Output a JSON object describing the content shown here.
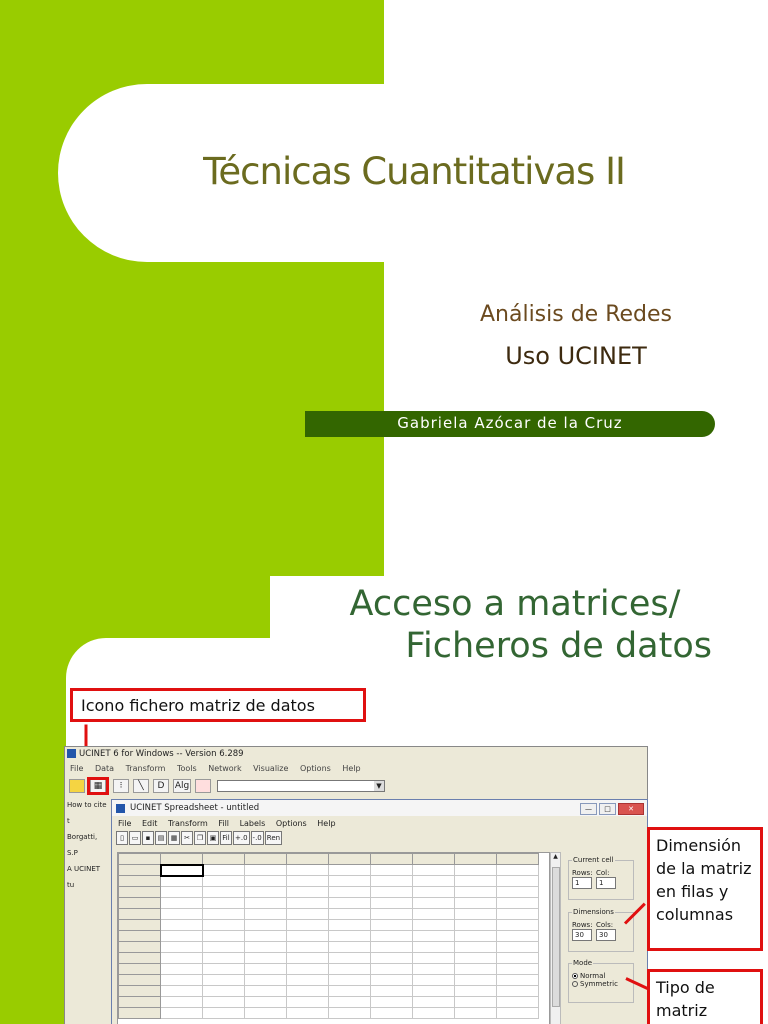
{
  "slide1": {
    "title": "Técnicas Cuantitativas II",
    "subtitle": "Análisis de Redes",
    "subtitle2": "Uso UCINET",
    "author": "Gabriela Azócar de la Cruz"
  },
  "slide2": {
    "title_line1": "Acceso a matrices/",
    "title_line2": "Ficheros de datos",
    "callout_icon": "Icono fichero matriz de datos",
    "callout_dim": "Dimensión de la matriz en filas y columnas",
    "callout_tipo": "Tipo de matriz",
    "colors": {
      "green": "#99cc00",
      "dark_green": "#336600",
      "callout_red": "#e01010"
    }
  },
  "ucinet": {
    "main_title": "UCINET 6 for Windows -- Version 6.289",
    "menu": [
      "File",
      "Data",
      "Transform",
      "Tools",
      "Network",
      "Visualize",
      "Options",
      "Help"
    ],
    "left_lines": [
      "How to cite t",
      "Borgatti, S.P",
      "A UCINET tu"
    ],
    "toolbar_labels": {
      "d": "D",
      "alg": "Alg"
    },
    "sheet_title": "UCINET Spreadsheet - untitled",
    "sheet_menu": [
      "File",
      "Edit",
      "Transform",
      "Fill",
      "Labels",
      "Options",
      "Help"
    ],
    "sheet_tools": [
      "Fil",
      "+.0",
      "-.0",
      "Ren"
    ],
    "current_cell": {
      "legend": "Current cell",
      "rows_label": "Rows:",
      "cols_label": "Col:",
      "row": "1",
      "col": "1"
    },
    "dimensions": {
      "legend": "Dimensions",
      "rows_label": "Rows:",
      "cols_label": "Cols:",
      "rows": "30",
      "cols": "30"
    },
    "mode": {
      "legend": "Mode",
      "normal": "Normal",
      "symmetric": "Symmetric"
    }
  }
}
